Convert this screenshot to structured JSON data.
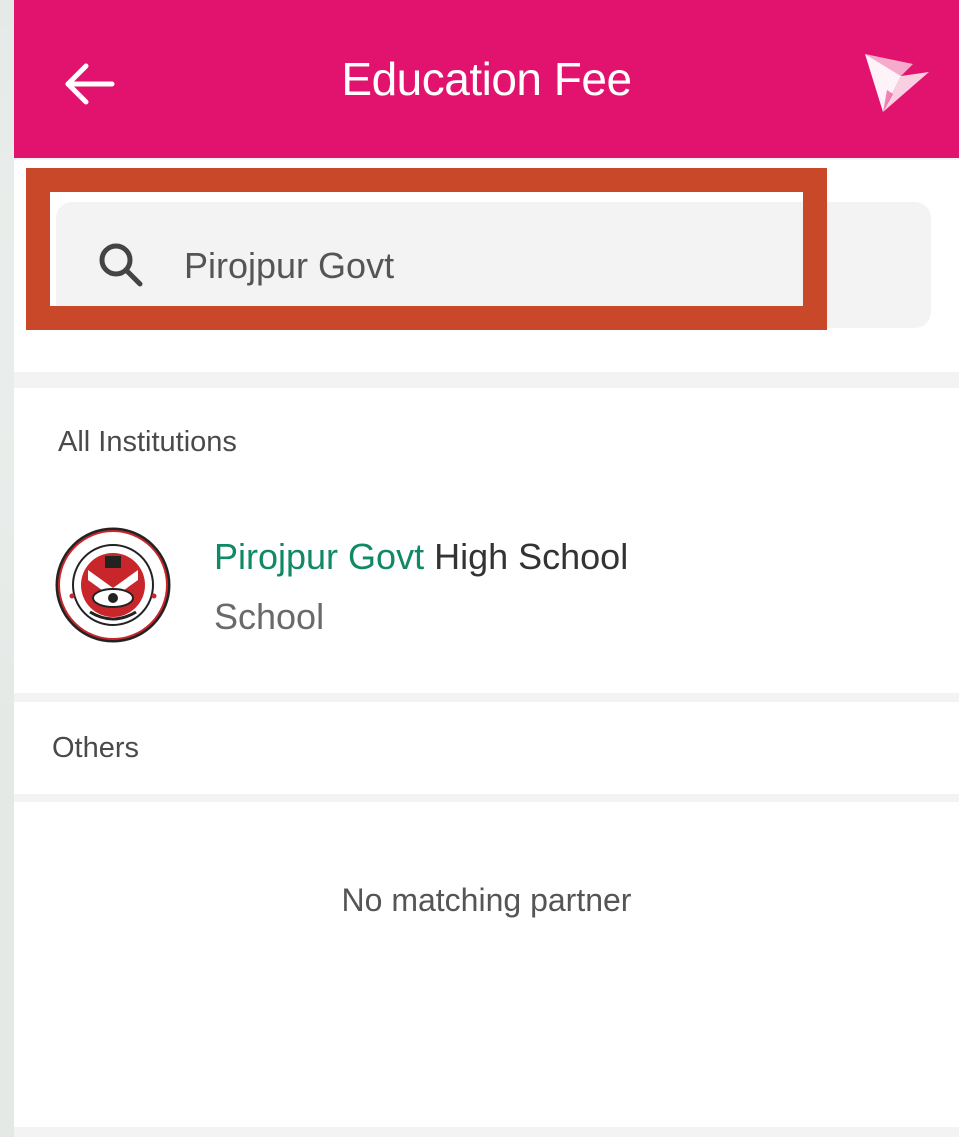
{
  "header": {
    "title": "Education Fee",
    "back_icon": "arrow-left-icon",
    "brand_icon": "bkash-bird-icon",
    "color": "#e2136e"
  },
  "search": {
    "value": "Pirojpur Govt",
    "icon": "search-icon"
  },
  "all_institutions": {
    "label": "All Institutions",
    "items": [
      {
        "name_match": "Pirojpur Govt",
        "name_rest": " High School",
        "type": "School",
        "logo": "school-crest-icon",
        "match_color": "#118866"
      }
    ]
  },
  "others": {
    "label": "Others",
    "empty_message": "No matching partner"
  },
  "highlight_color": "#c9482a"
}
